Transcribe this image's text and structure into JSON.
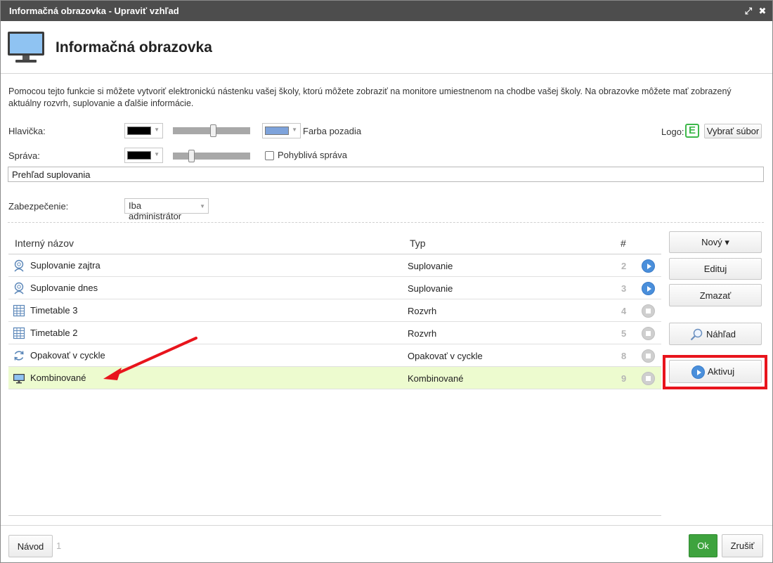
{
  "window": {
    "title": "Informačná obrazovka - Upraviť vzhľad",
    "maximize_glyph": "⤢",
    "close_glyph": "✖"
  },
  "header": {
    "title": "Informačná obrazovka",
    "icon": "monitor-icon"
  },
  "description": "Pomocou tejto funkcie si môžete vytvoriť elektronickú nástenku vašej školy, ktorú môžete zobraziť na monitore umiestnenom na chodbe vašej školy. Na obrazovke môžete mať zobrazený aktuálny rozvrh, suplovanie a ďalšie informácie.",
  "form": {
    "header_label": "Hlavička:",
    "header_text_color": "#000000",
    "header_slider_value": 0.5,
    "bg_color": "#7ea3db",
    "bg_label": "Farba pozadia",
    "logo_label": "Logo:",
    "logo_letter": "E",
    "logo_button": "Vybrať súbor",
    "message_label": "Správa:",
    "message_text_color": "#000000",
    "message_slider_value": 0.25,
    "moving_message_label": "Pohyblivá správa",
    "moving_message_checked": false,
    "message_value": "Prehľad suplovania",
    "security_label": "Zabezpečenie:",
    "security_value": "Iba administrátor"
  },
  "table": {
    "columns": [
      "Interný názov",
      "Typ",
      "#"
    ],
    "rows": [
      {
        "icon": "substitution-icon",
        "name": "Suplovanie zajtra",
        "type": "Suplovanie",
        "num": "2",
        "active": true
      },
      {
        "icon": "substitution-icon",
        "name": "Suplovanie dnes",
        "type": "Suplovanie",
        "num": "3",
        "active": true
      },
      {
        "icon": "timetable-icon",
        "name": "Timetable 3",
        "type": "Rozvrh",
        "num": "4",
        "active": false
      },
      {
        "icon": "timetable-icon",
        "name": "Timetable 2",
        "type": "Rozvrh",
        "num": "5",
        "active": false
      },
      {
        "icon": "cycle-icon",
        "name": "Opakovať v cyckle",
        "type": "Opakovať v cyckle",
        "num": "8",
        "active": false
      },
      {
        "icon": "monitor-icon",
        "name": "Kombinované",
        "type": "Kombinované",
        "num": "9",
        "active": false,
        "selected": true
      }
    ]
  },
  "side_buttons": {
    "new": "Nový ▾",
    "edit": "Edituj",
    "delete": "Zmazať",
    "preview": "Náhľad",
    "activate": "Aktivuj"
  },
  "footer": {
    "guide": "Návod",
    "guide_count": "1",
    "ok": "Ok",
    "cancel": "Zrušiť"
  },
  "colors": {
    "ok_button": "#3ea33e",
    "highlight": "#e8141c",
    "selected_row": "#edfbcf"
  }
}
